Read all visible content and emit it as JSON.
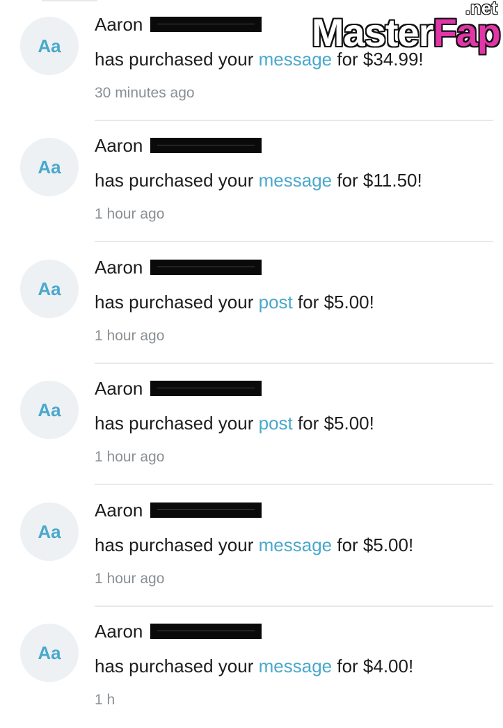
{
  "watermark": {
    "part1": "Master",
    "part2": "Fap",
    "tld": ".net"
  },
  "notifications": [
    {
      "avatar": "Aa",
      "name": "Aaron",
      "prefix": "has purchased your",
      "link": "message",
      "suffix": "for $34.99!",
      "time": "30 minutes ago"
    },
    {
      "avatar": "Aa",
      "name": "Aaron",
      "prefix": "has purchased your",
      "link": "message",
      "suffix": "for $11.50!",
      "time": "1 hour ago"
    },
    {
      "avatar": "Aa",
      "name": "Aaron",
      "prefix": "has purchased your",
      "link": "post",
      "suffix": "for $5.00!",
      "time": "1 hour ago"
    },
    {
      "avatar": "Aa",
      "name": "Aaron",
      "prefix": "has purchased your",
      "link": "post",
      "suffix": "for $5.00!",
      "time": "1 hour ago"
    },
    {
      "avatar": "Aa",
      "name": "Aaron",
      "prefix": "has purchased your",
      "link": "message",
      "suffix": "for $5.00!",
      "time": "1 hour ago"
    },
    {
      "avatar": "Aa",
      "name": "Aaron",
      "prefix": "has purchased your",
      "link": "message",
      "suffix": "for $4.00!",
      "time": "1 h"
    }
  ]
}
